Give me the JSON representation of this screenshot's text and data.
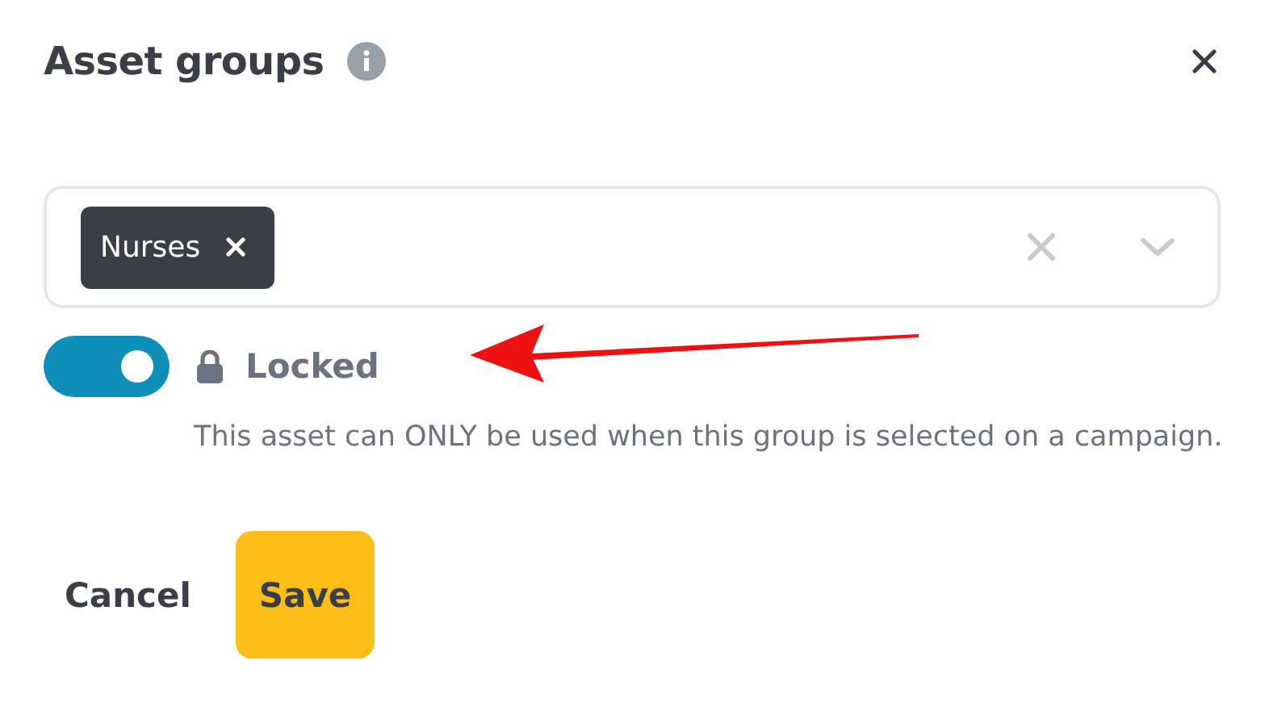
{
  "dialog": {
    "title": "Asset groups"
  },
  "select": {
    "tags": [
      {
        "label": "Nurses"
      }
    ]
  },
  "lock_toggle": {
    "on": true,
    "label": "Locked",
    "description": "This asset can ONLY be used when this group is selected on a campaign."
  },
  "annotation": {
    "kind": "arrow"
  },
  "buttons": [
    {
      "label": "Cancel",
      "kind": "text"
    },
    {
      "label": "Save",
      "kind": "primary"
    }
  ]
}
